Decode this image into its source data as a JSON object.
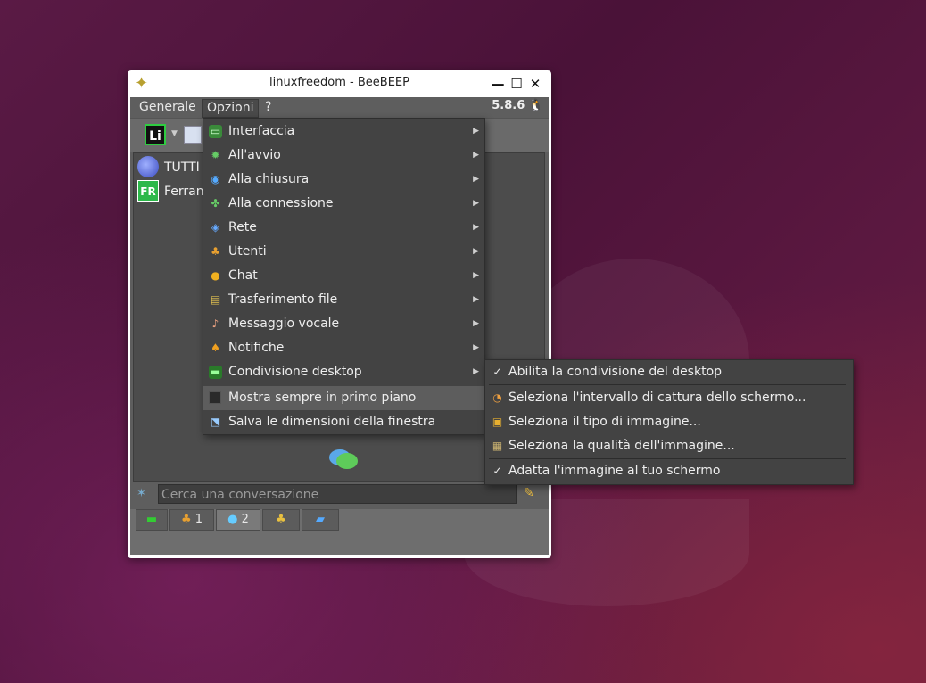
{
  "window": {
    "title": "linuxfreedom - BeeBEEP",
    "minimize_glyph": "—",
    "maximize_glyph": "☐",
    "close_glyph": "✕"
  },
  "menubar": {
    "items": [
      "Generale",
      "Opzioni",
      "?"
    ],
    "version": "5.8.6"
  },
  "toolbar": {
    "badge": "Li"
  },
  "list": {
    "items": [
      {
        "avatar": "",
        "label": "TUTTI"
      },
      {
        "avatar": "FR",
        "label": "Ferran"
      }
    ]
  },
  "search": {
    "placeholder": "Cerca una conversazione"
  },
  "tabs": [
    {
      "label": ""
    },
    {
      "label": "1"
    },
    {
      "label": "2"
    },
    {
      "label": ""
    },
    {
      "label": ""
    }
  ],
  "options_menu": {
    "items": [
      {
        "label": "Interfaccia",
        "icon": "monitor-icon"
      },
      {
        "label": "All'avvio",
        "icon": "gear-icon"
      },
      {
        "label": "Alla chiusura",
        "icon": "power-icon"
      },
      {
        "label": "Alla connessione",
        "icon": "connection-icon"
      },
      {
        "label": "Rete",
        "icon": "network-icon"
      },
      {
        "label": "Utenti",
        "icon": "users-icon"
      },
      {
        "label": "Chat",
        "icon": "chat-icon"
      },
      {
        "label": "Trasferimento file",
        "icon": "file-transfer-icon"
      },
      {
        "label": "Messaggio vocale",
        "icon": "microphone-icon"
      },
      {
        "label": "Notifiche",
        "icon": "bell-icon"
      },
      {
        "label": "Condivisione desktop",
        "icon": "desktop-share-icon"
      }
    ],
    "always_on_top": "Mostra sempre in primo piano",
    "save_size": "Salva le dimensioni della finestra"
  },
  "desktop_submenu": {
    "items": [
      {
        "label": "Abilita la condivisione del desktop",
        "icon": "check-icon"
      },
      {
        "label": "Seleziona l'intervallo di cattura dello schermo...",
        "icon": "timer-icon"
      },
      {
        "label": "Seleziona il tipo di immagine...",
        "icon": "image-type-icon"
      },
      {
        "label": "Seleziona la qualità dell'immagine...",
        "icon": "image-quality-icon"
      },
      {
        "label": "Adatta l'immagine al tuo schermo",
        "icon": "check-icon"
      }
    ]
  },
  "colors": {
    "menu_bg": "#434343",
    "window_bg": "#5e5e5e",
    "accent_green": "#2ecc40"
  }
}
